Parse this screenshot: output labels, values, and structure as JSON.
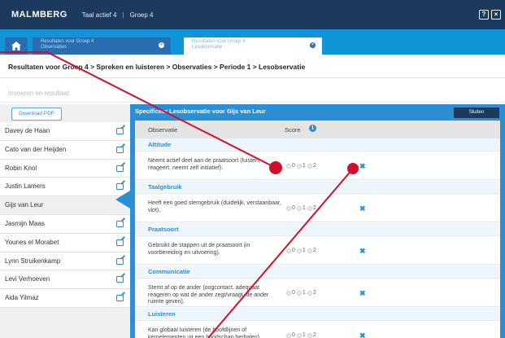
{
  "header": {
    "logo": "MALMBERG",
    "course": "Taal actief 4",
    "separator": "|",
    "group": "Groep 4",
    "help_label": "?",
    "close_label": "×"
  },
  "tabs": [
    {
      "line1": "Resultaten voor Groep 4",
      "line2": "Observaties",
      "close": "×"
    },
    {
      "line1": "Resultaten voor Groep 4",
      "line2": "Lesobservatie",
      "close": "×"
    }
  ],
  "breadcrumb": "Resultaten voor Groep 4 > Spreken en luisteren > Observaties > Periode 1 > Lesobservatie",
  "entry_label": "Invoeren en resultaat",
  "download_label": "Download PDF",
  "students": [
    {
      "name": "Davey de Haan"
    },
    {
      "name": "Cato van der Heijden"
    },
    {
      "name": "Robin Knol"
    },
    {
      "name": "Justin Lamers"
    },
    {
      "name": "Gijs van Leur",
      "selected": true
    },
    {
      "name": "Jasmijn Maas"
    },
    {
      "name": "Younes el Morabet"
    },
    {
      "name": "Lynn Struikenkamp"
    },
    {
      "name": "Levi Verhoeven"
    },
    {
      "name": "Aida Yilmaz"
    }
  ],
  "panel": {
    "title": "Specificeer Lesobservatie voor Gijs van Leur",
    "close_label": "Sluiten",
    "col_observatie": "Observatie",
    "col_score": "Score",
    "info_glyph": "i",
    "score_options": [
      "0",
      "1",
      "2"
    ],
    "clear_glyph": "✖",
    "rows": [
      {
        "type": "cat",
        "label": "Attitude"
      },
      {
        "type": "obs",
        "text": "Neemt actief deel aan de praatsoort (luistert, reageert, neemt zelf initiatief)."
      },
      {
        "type": "cat",
        "label": "Taalgebruik"
      },
      {
        "type": "obs",
        "text": "Heeft een goed stemgebruik (duidelijk, verstaanbaar, vlot)."
      },
      {
        "type": "cat",
        "label": "Praatsoort"
      },
      {
        "type": "obs",
        "text": "Gebruikt de stappen uit de praatsoort (in voorbereiding en uitvoering)."
      },
      {
        "type": "cat",
        "label": "Communicatie"
      },
      {
        "type": "obs",
        "text": "Stemt af op de ander (oogcontact, adequaat reageren op wat de ander zegt/vraagt, de ander ruimte geven)."
      },
      {
        "type": "cat",
        "label": "Luisteren"
      },
      {
        "type": "obs",
        "text": "Kan globaal luisteren (de hoofdlijnen of kernelementen uit een boodschap herhalen)."
      }
    ]
  },
  "colors": {
    "topbar": "#1b3a5e",
    "tabbar": "#0f95d8",
    "accent": "#2c8fd6",
    "annotation": "#d0102a"
  }
}
